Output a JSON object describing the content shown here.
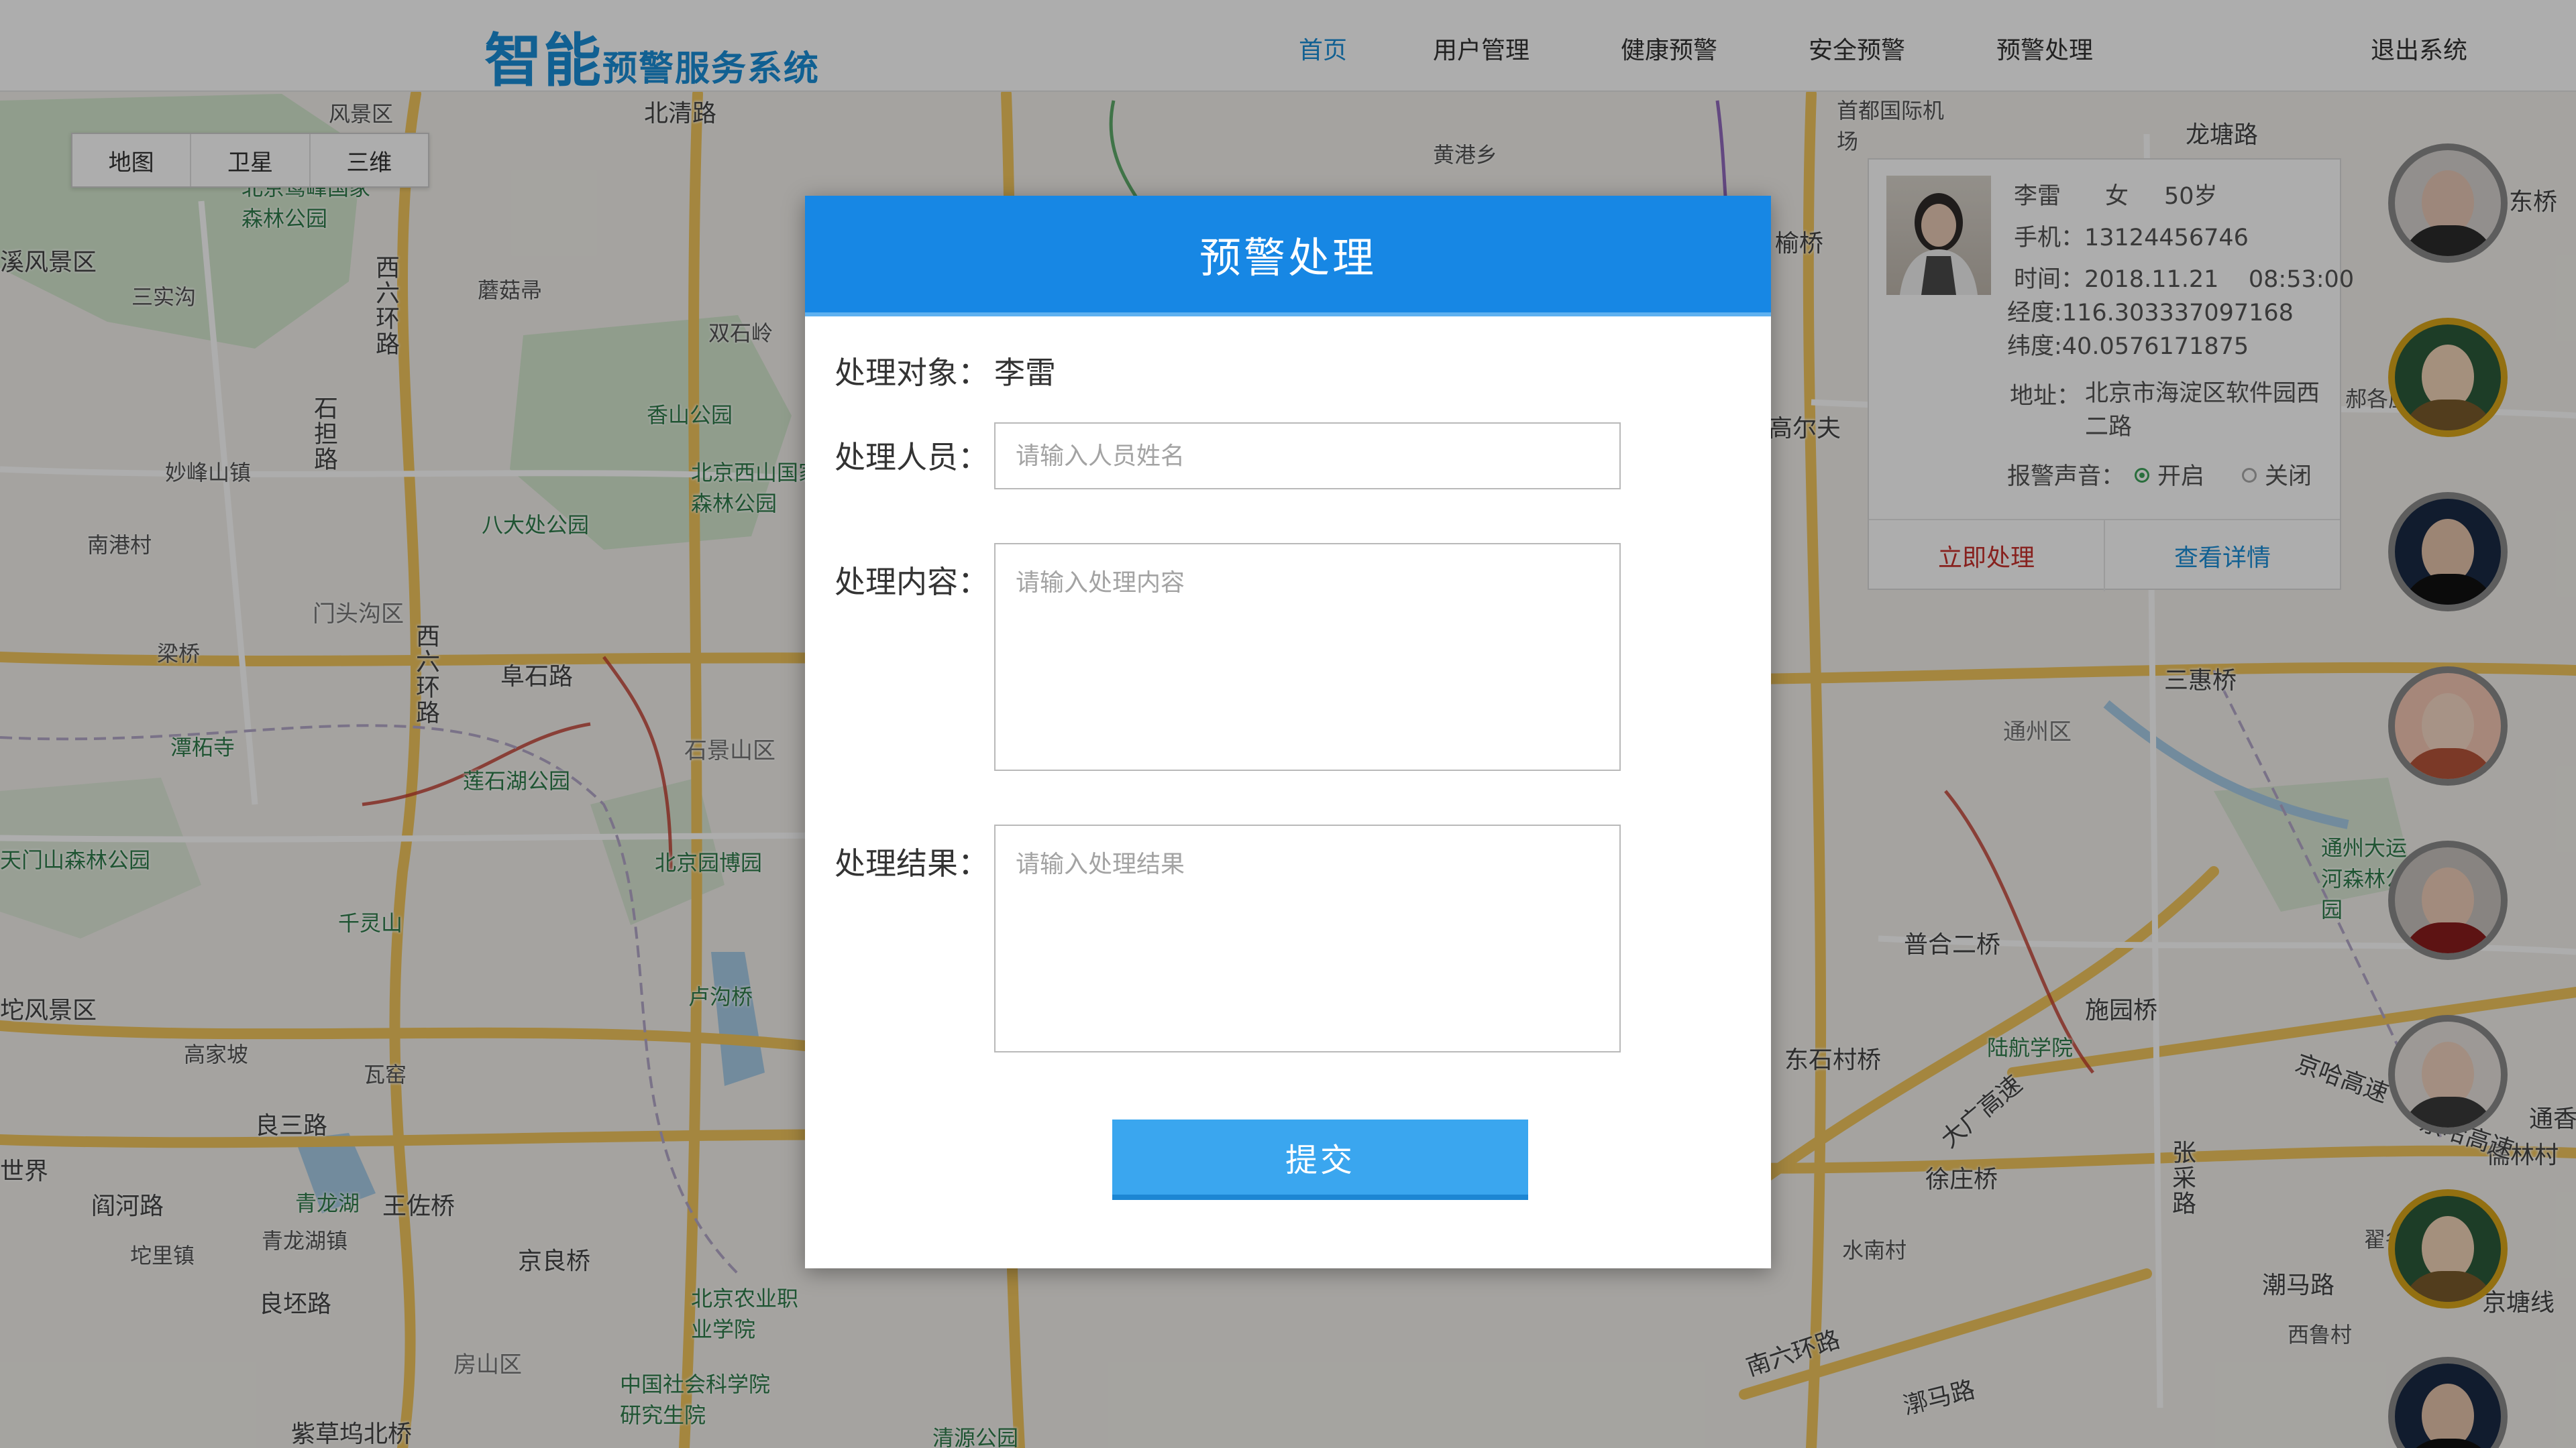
{
  "header": {
    "logo_big": "智能",
    "logo_small": "预警服务系统",
    "nav": [
      "首页",
      "用户管理",
      "健康预警",
      "安全预警",
      "预警处理"
    ],
    "logout": "退出系统"
  },
  "map_type": [
    "地图",
    "卫星",
    "三维"
  ],
  "map_labels": {
    "l1": "风景区",
    "l2": "北清路",
    "l3": "北京鹫峰国家森林公园",
    "l4": "溪风景区",
    "l5": "三实沟",
    "l6": "西六环路",
    "l7": "蘑菇帚",
    "l8": "双石岭",
    "l9": "香山公园",
    "l10": "北京西山国家森林公园",
    "l11": "石担路",
    "l12": "妙峰山镇",
    "l13": "八大处公园",
    "l14": "南港村",
    "l15": "门头沟区",
    "l16": "梁桥",
    "l17": "西六环路",
    "l18": "阜石路",
    "l19": "石景山区",
    "l20": "潭柘寺",
    "l21": "莲石湖公园",
    "l22": "天门山森林公园",
    "l23": "北京园博园",
    "l24": "千灵山",
    "l25": "卢沟桥",
    "l26": "坨风景区",
    "l27": "高家坡",
    "l28": "瓦窑",
    "l29": "良三路",
    "l30": "世界",
    "l31": "阎河路",
    "l32": "青龙湖",
    "l33": "王佐桥",
    "l34": "青龙湖镇",
    "l35": "坨里镇",
    "l36": "良坯路",
    "l37": "京良桥",
    "l38": "北京农业职业学院",
    "l39": "房山区",
    "l40": "中国社会科学院研究生院",
    "l41": "紫草坞北桥",
    "l42": "清源公园",
    "l43": "首都国际机场",
    "l44": "龙塘路",
    "l45": "三惠桥",
    "l46": "通州区",
    "l47": "普合二桥",
    "l48": "施园桥",
    "l49": "东石村桥",
    "l50": "陆航学院",
    "l51": "大广高速",
    "l52": "京哈高速",
    "l53": "徐庄桥",
    "l54": "张采路",
    "l55": "水南村",
    "l56": "潮马路",
    "l57": "南六环路",
    "l58": "通州大运河森林公园",
    "l59": "漷马路",
    "l60": "黄港乡",
    "l61": "榆桥",
    "l62": "高尔夫",
    "l63": "东桥",
    "l64": "郝各庄",
    "l65": "翟各庄",
    "l66": "西鲁村",
    "l67": "通香",
    "l68": "儒林村",
    "l69": "京哈高速",
    "l70": "京塘线"
  },
  "info_card": {
    "name": "李雷",
    "gender": "女",
    "age": "50岁",
    "phone": "手机：13124456746",
    "time": "时间：2018.11.21    08:53:00",
    "lng": "经度:116.303337097168",
    "lat": "纬度:40.0576171875",
    "address_label": "地址：",
    "address": "北京市海淀区软件园西二路",
    "sound_label": "报警声音：",
    "sound_on": "开启",
    "sound_off": "关闭",
    "btn_handle": "立即处理",
    "btn_detail": "查看详情"
  },
  "modal": {
    "title": "预警处理",
    "target_label": "处理对象：",
    "target_value": "李雷",
    "person_label": "处理人员：",
    "person_placeholder": "请输入人员姓名",
    "content_label": "处理内容：",
    "content_placeholder": "请输入处理内容",
    "result_label": "处理结果：",
    "result_placeholder": "请输入处理结果",
    "submit": "提交"
  },
  "colors": {
    "brand": "#1a8ed8",
    "modal_header": "#1787e4",
    "submit": "#3aa6ef",
    "danger": "#c8322d"
  }
}
